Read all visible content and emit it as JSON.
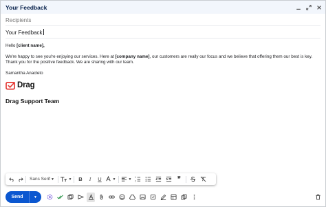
{
  "window": {
    "title": "Your Feedback"
  },
  "recipients": {
    "placeholder": "Recipients"
  },
  "subject": {
    "value": "Your Feedback"
  },
  "message": {
    "greeting_prefix": "Hello ",
    "greeting_bold": "[client name],",
    "p1_a": "We're happy to see you're enjoying our services. Here at ",
    "p1_bold": "[company name]",
    "p1_b": ", our customers are really our focus and we believe that offering them our best is key. Thank you for the positive feedback. We are sharing with our team.",
    "sig_name": "Samantha Anacleto",
    "logo_text": "Drag",
    "team": "Drag Support Team"
  },
  "format_bar": {
    "font": "Sans Serif"
  },
  "send": {
    "label": "Send"
  },
  "colors": {
    "accent": "#0b57d0",
    "logo_red": "#e53935",
    "title_bar": "#f2f6fc"
  }
}
